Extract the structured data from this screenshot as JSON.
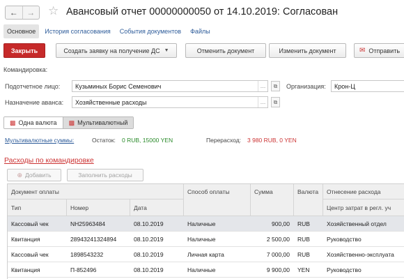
{
  "window": {
    "title": "Авансовый отчет 00000000050 от 14.10.2019: Согласован",
    "back_icon": "arrow-left-icon",
    "forward_icon": "arrow-right-icon",
    "star_icon": "star-icon"
  },
  "tabs": [
    {
      "label": "Основное",
      "active": true
    },
    {
      "label": "История согласования",
      "active": false
    },
    {
      "label": "События документов",
      "active": false
    },
    {
      "label": "Файлы",
      "active": false
    }
  ],
  "toolbar": {
    "close_label": "Закрыть",
    "create_request_label": "Создать заявку на получение ДС",
    "cancel_doc_label": "Отменить документ",
    "edit_doc_label": "Изменить документ",
    "send_label": "Отправить"
  },
  "form": {
    "trip_label": "Командировка:",
    "accountable_label": "Подотчетное лицо:",
    "accountable_value": "Кузьминых Борис Семенович",
    "org_label": "Организация:",
    "org_value": "Крон-Ц",
    "purpose_label": "Назначение аванса:",
    "purpose_value": "Хозяйственные расходы"
  },
  "currency_toggle": {
    "single_label": "Одна валюта",
    "multi_label": "Мультивалютный",
    "selected": "multi"
  },
  "summary": {
    "multi_sums_label": "Мультивалютные суммы:",
    "balance_label": "Остаток:",
    "balance_value": "0 RUB, 15000 YEN",
    "overspend_label": "Перерасход:",
    "overspend_value": "3 980 RUB, 0 YEN"
  },
  "expenses": {
    "title": "Расходы по командировке",
    "add_label": "Добавить",
    "fill_label": "Заполнить расходы",
    "group_header": "Документ оплаты",
    "columns": {
      "type": "Тип",
      "number": "Номер",
      "date": "Дата",
      "payment_method": "Способ оплаты",
      "amount": "Сумма",
      "currency": "Валюта",
      "expense_assignment": "Отнесение расхода",
      "cost_center": "Центр затрат в регл. уч"
    },
    "rows": [
      {
        "type": "Кассовый чек",
        "number": "NH25963484",
        "date": "08.10.2019",
        "payment_method": "Наличные",
        "amount": "900,00",
        "currency": "RUB",
        "expense": "Хозяйственный отдел",
        "selected": true
      },
      {
        "type": "Квитанция",
        "number": "28943241324894",
        "date": "08.10.2019",
        "payment_method": "Наличные",
        "amount": "2 500,00",
        "currency": "RUB",
        "expense": "Руководство",
        "selected": false
      },
      {
        "type": "Кассовый чек",
        "number": "1898543232",
        "date": "08.10.2019",
        "payment_method": "Личная карта",
        "amount": "7 000,00",
        "currency": "RUB",
        "expense": "Хозяйственно-эксплуата",
        "selected": false
      },
      {
        "type": "Квитанция",
        "number": "П-852496",
        "date": "08.10.2019",
        "payment_method": "Наличные",
        "amount": "9 900,00",
        "currency": "YEN",
        "expense": "Руководство",
        "selected": false
      }
    ]
  },
  "colors": {
    "primary": "#c62a2a",
    "link": "#2e5c9a",
    "positive": "#2a8a2a",
    "negative": "#cc3333",
    "selected_row": "#e4e6ea"
  }
}
